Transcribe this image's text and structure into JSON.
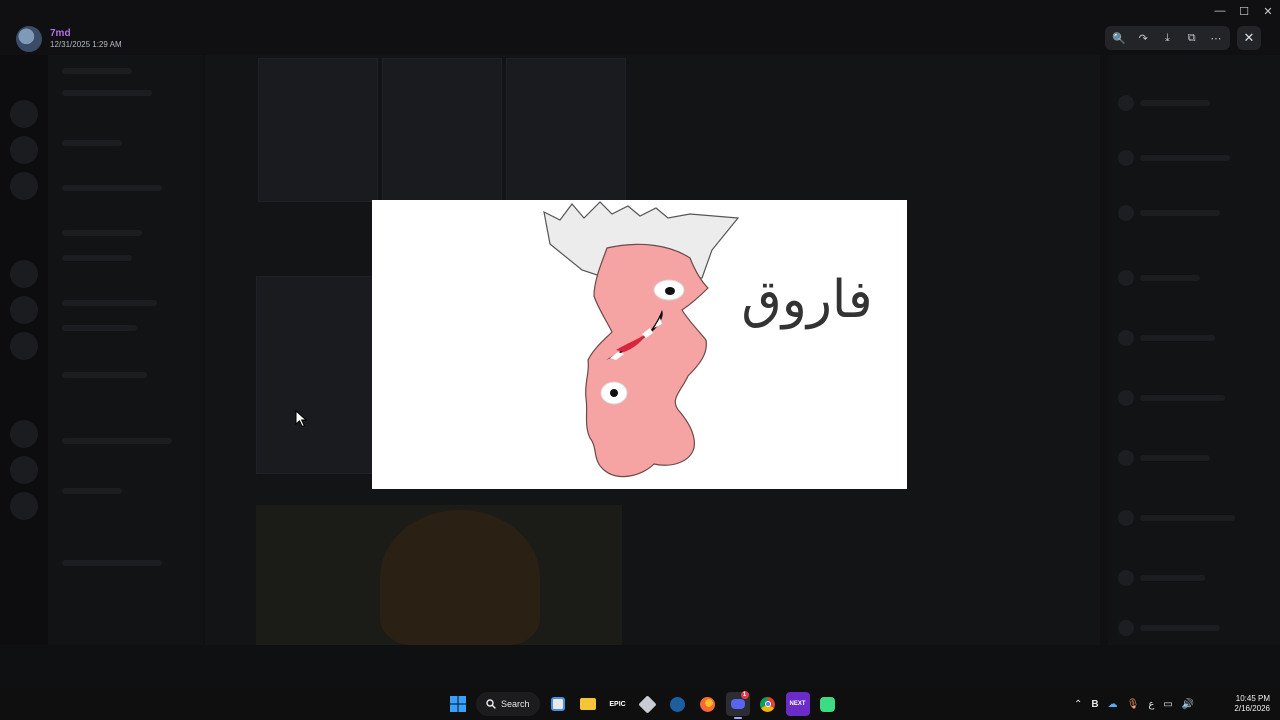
{
  "author": {
    "name": "7md",
    "date": "12/31/2025 1:29 AM"
  },
  "window": {
    "title": "Discord",
    "controls": [
      "minimize",
      "maximize",
      "close"
    ]
  },
  "toolbar": {
    "buttons": [
      {
        "name": "zoom-icon",
        "glyph": "🔍"
      },
      {
        "name": "forward-icon",
        "glyph": "↷"
      },
      {
        "name": "download-icon",
        "glyph": "⤓"
      },
      {
        "name": "open-external-icon",
        "glyph": "⧉"
      },
      {
        "name": "more-icon",
        "glyph": "⋯"
      }
    ],
    "close_glyph": "✕"
  },
  "image": {
    "handwritten_text": "فاروق"
  },
  "taskbar": {
    "search_label": "Search",
    "apps": [
      {
        "name": "widgets-icon"
      },
      {
        "name": "file-explorer-icon"
      },
      {
        "name": "epic-games-icon",
        "label": "EPIC"
      },
      {
        "name": "unity-icon"
      },
      {
        "name": "steam-icon"
      },
      {
        "name": "firefox-icon"
      },
      {
        "name": "discord-icon",
        "badge": "1"
      },
      {
        "name": "chrome-icon"
      },
      {
        "name": "next-app-icon",
        "label": "NEXT"
      },
      {
        "name": "android-app-icon"
      }
    ],
    "tray": {
      "language": "ع"
    },
    "clock": {
      "time": "10:45 PM",
      "date": "2/16/2026"
    }
  }
}
